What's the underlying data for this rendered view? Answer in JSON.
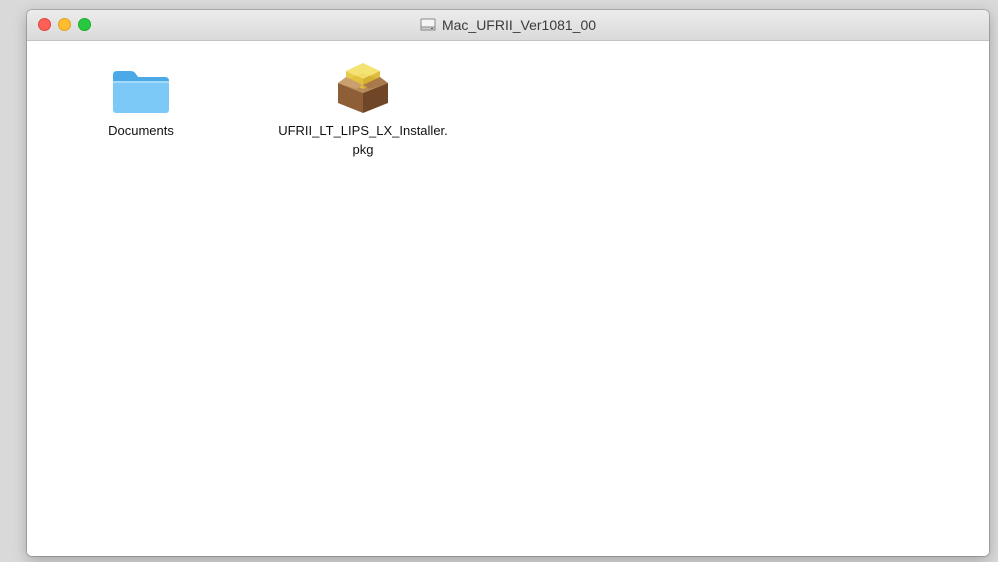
{
  "window": {
    "title": "Mac_UFRII_Ver1081_00",
    "title_icon": "disk-image-icon"
  },
  "files": [
    {
      "name": "Documents",
      "icon": "folder-icon"
    },
    {
      "name": "UFRII_LT_LIPS_LX_Installer.\npkg",
      "icon": "package-installer-icon"
    }
  ],
  "colors": {
    "close": "#fe5f57",
    "minimize": "#febc2e",
    "zoom": "#28c840",
    "folder": "#64b9f0"
  }
}
